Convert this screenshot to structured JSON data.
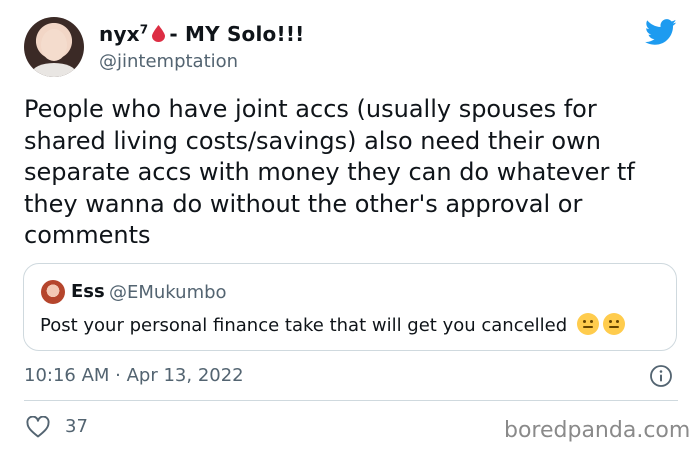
{
  "author": {
    "display_name_prefix": "nyx",
    "display_name_sup": "7",
    "display_name_suffix": "- MY Solo!!!",
    "handle": "@jintemptation"
  },
  "tweet": {
    "text": "People who have joint accs (usually spouses for\nshared living costs/savings) also need their own\nseparate accs with money they can do whatever tf\nthey wanna do without the other's approval or\ncomments",
    "timestamp": "10:16 AM · Apr 13, 2022",
    "likes": "37"
  },
  "quote": {
    "name": "Ess",
    "handle": "@EMukumbo",
    "text": "Post your personal finance take that will get you cancelled"
  },
  "icons": {
    "brand": "twitter-bird-icon",
    "drop": "red-drop-icon",
    "info": "info-icon",
    "like": "heart-icon",
    "emoji1": "hand-over-mouth-emoji",
    "emoji2": "thinking-face-emoji"
  },
  "watermark": "boredpanda.com",
  "colors": {
    "twitter_blue": "#1d9bf0",
    "drop_red": "#dd2e44",
    "secondary_text": "#536471",
    "border": "#cfd9de"
  }
}
